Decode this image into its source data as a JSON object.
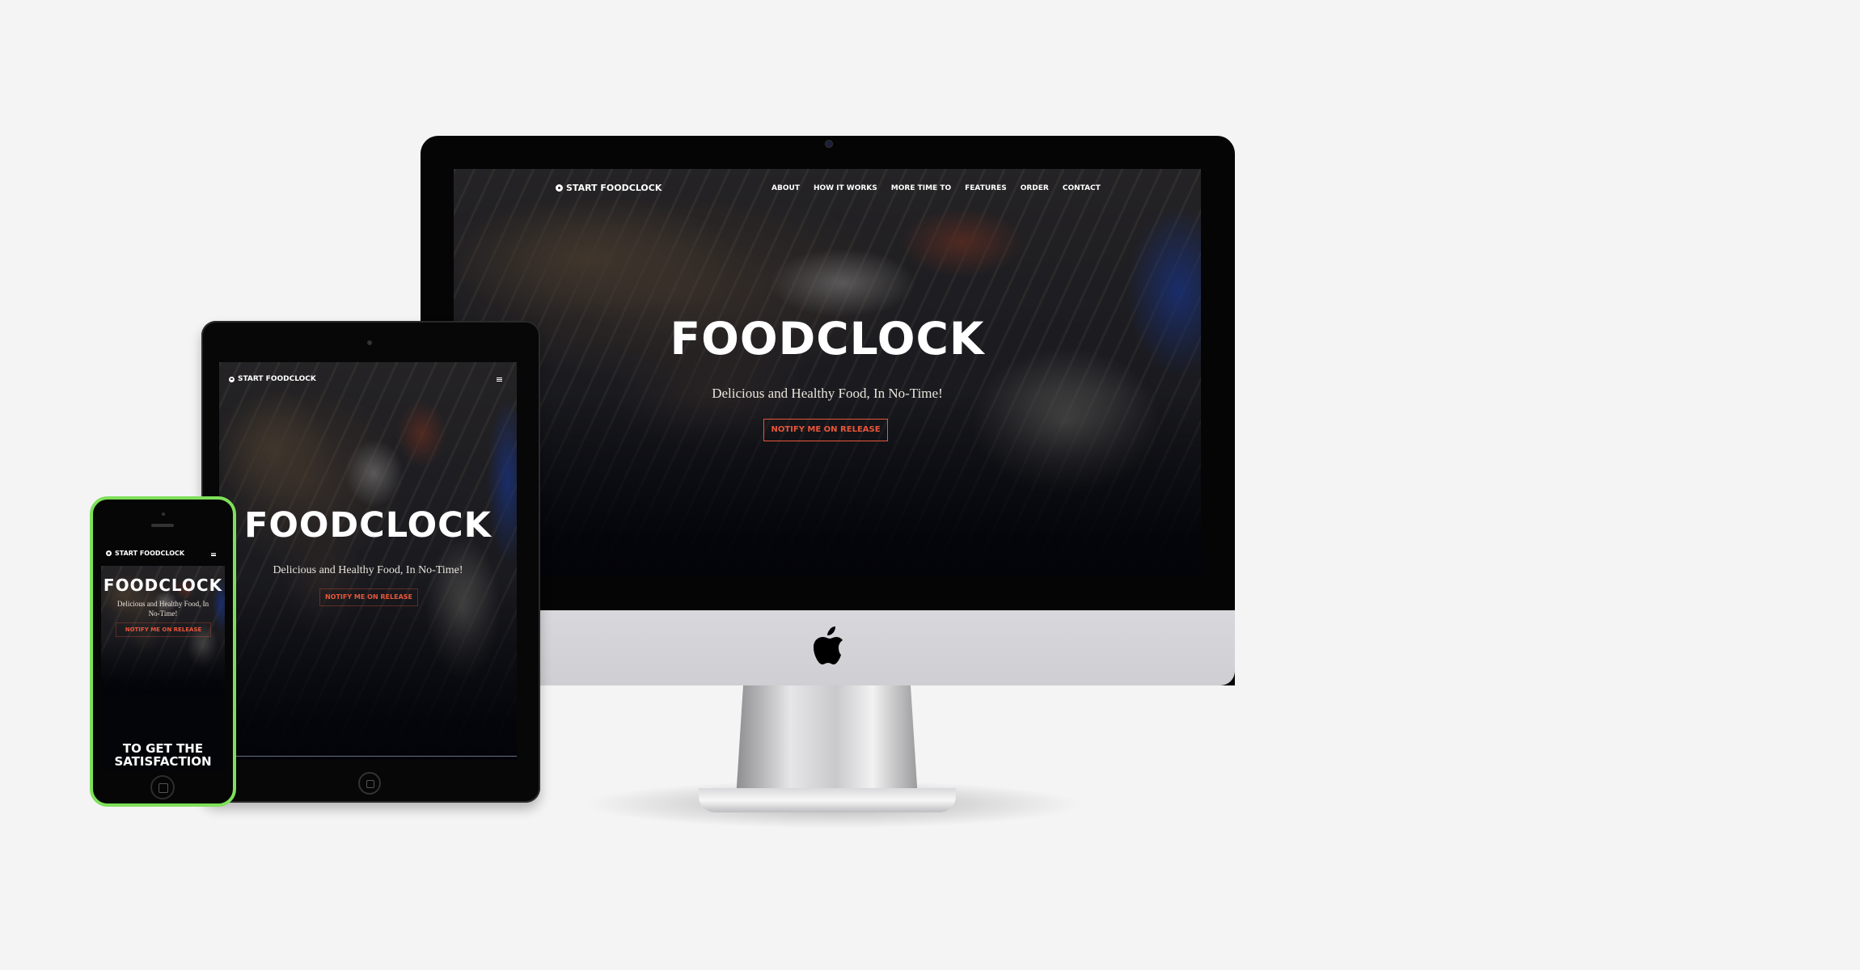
{
  "site": {
    "brand": "START FOODCLOCK",
    "nav": [
      "ABOUT",
      "HOW IT WORKS",
      "MORE TIME TO",
      "FEATURES",
      "ORDER",
      "CONTACT"
    ],
    "hero_title": "FOODCLOCK",
    "hero_subtitle": "Delicious and Healthy Food, In No-Time!",
    "cta": "NOTIFY ME ON RELEASE",
    "tagline": "TO GET THE SATISFACTION"
  },
  "colors": {
    "accent": "#e8563a",
    "phone_bezel": "#7ee05a",
    "background": "#f4f4f4"
  },
  "icons": {
    "menu": "hamburger-menu-icon",
    "brand": "clock-logo-icon",
    "device_logo": "apple-logo-icon"
  }
}
